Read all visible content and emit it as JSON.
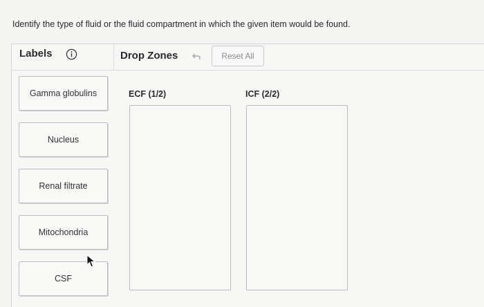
{
  "instructions": "Identify the type of fluid or the fluid compartment in which the given item would be found.",
  "labels_panel": {
    "title": "Labels",
    "items": [
      {
        "label": "Gamma globulins"
      },
      {
        "label": "Nucleus"
      },
      {
        "label": "Renal filtrate"
      },
      {
        "label": "Mitochondria"
      },
      {
        "label": "CSF"
      }
    ]
  },
  "drop_zones_panel": {
    "title": "Drop Zones",
    "reset_label": "Reset All",
    "zones": [
      {
        "label": "ECF (1/2)"
      },
      {
        "label": "ICF (2/2)"
      }
    ]
  },
  "icons": {
    "info": "info-circle-icon",
    "undo": "undo-arrow-icon",
    "cursor": "mouse-pointer-icon"
  },
  "colors": {
    "background": "#f4f4f3",
    "border": "#bdbdbd",
    "muted_text": "#8d8d8d"
  }
}
